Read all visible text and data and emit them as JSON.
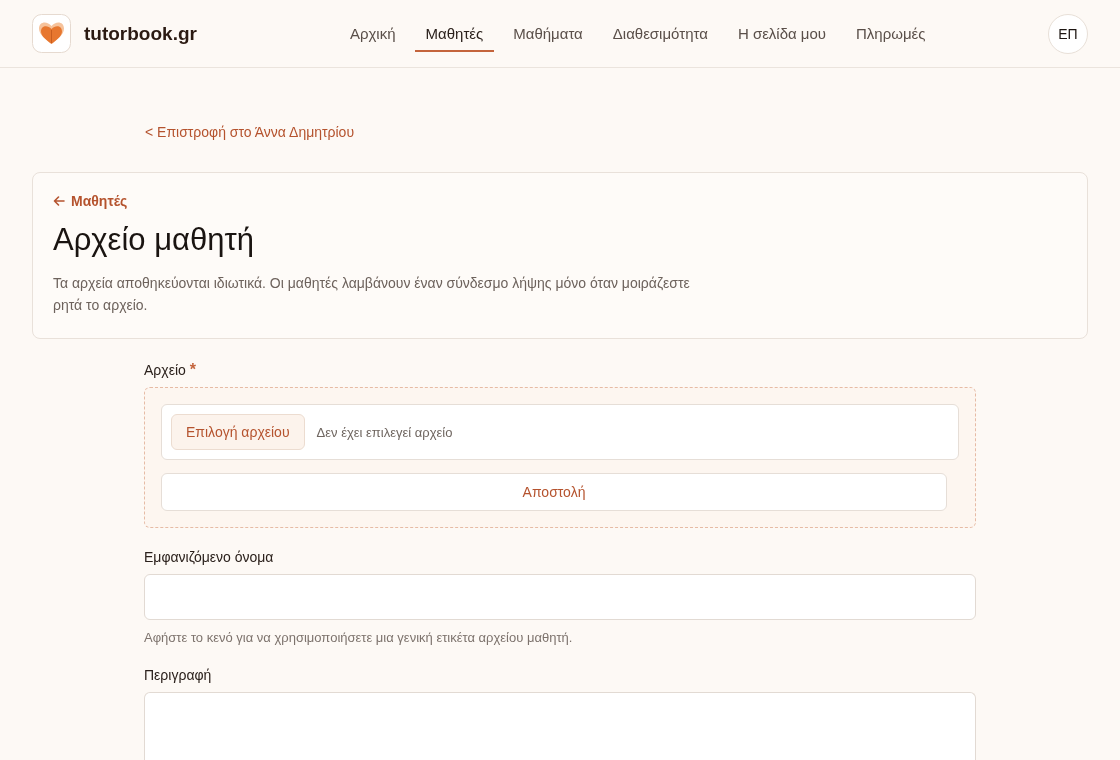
{
  "header": {
    "brand": "tutorbook.gr",
    "nav": [
      {
        "label": "Αρχική",
        "selected": false
      },
      {
        "label": "Μαθητές",
        "selected": true
      },
      {
        "label": "Μαθήματα",
        "selected": false
      },
      {
        "label": "Διαθεσιμότητα",
        "selected": false
      },
      {
        "label": "Η σελίδα μου",
        "selected": false
      },
      {
        "label": "Πληρωμές",
        "selected": false
      }
    ],
    "avatar": "ΕΠ"
  },
  "back_link": "< Επιστροφή στο Άννα Δημητρίου",
  "card": {
    "breadcrumb": "Μαθητές",
    "title": "Αρχείο μαθητή",
    "description": "Τα αρχεία αποθηκεύονται ιδιωτικά. Οι μαθητές λαμβάνουν έναν σύνδεσμο λήψης μόνο όταν μοιράζεστε ρητά το αρχείο."
  },
  "form": {
    "file": {
      "label": "Αρχείο",
      "required_mark": "*",
      "choose_button": "Επιλογή αρχείου",
      "status": "Δεν έχει επιλεγεί αρχείο",
      "upload_button": "Αποστολή"
    },
    "fields": [
      {
        "kind": "input",
        "label": "Εμφανιζόμενο όνομα",
        "hint": "Αφήστε το κενό για να χρησιμοποιήσετε μια γενική ετικέτα αρχείου μαθητή."
      },
      {
        "kind": "textarea",
        "label": "Περιγραφή"
      }
    ]
  }
}
